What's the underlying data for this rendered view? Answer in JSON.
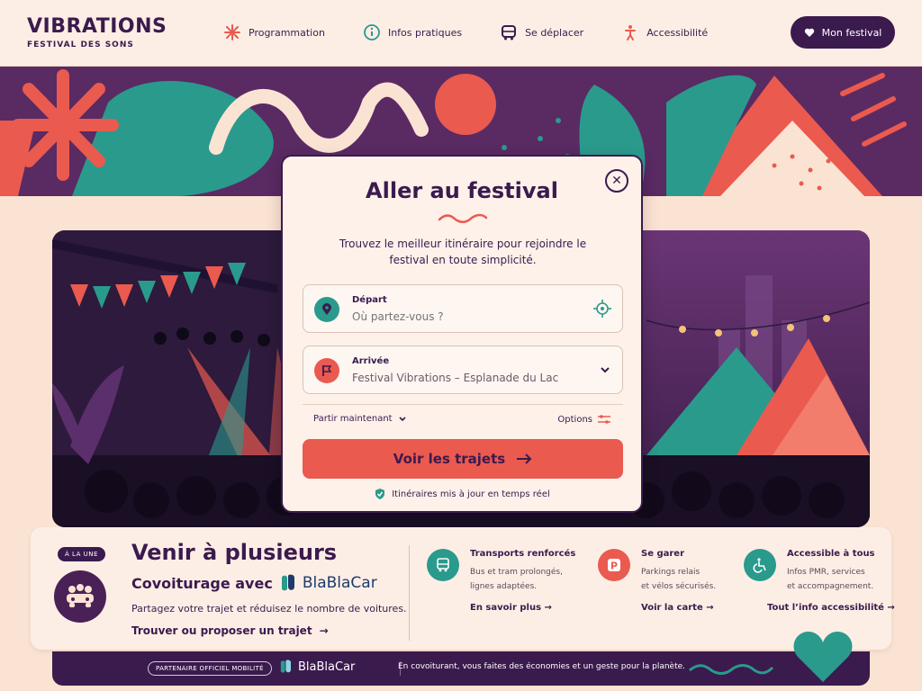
{
  "header": {
    "logo_title": "VIBRATIONS",
    "logo_subtitle": "FESTIVAL DES SONS",
    "nav": [
      {
        "label": "Programmation",
        "icon": "sparkle-icon"
      },
      {
        "label": "Infos pratiques",
        "icon": "info-icon"
      },
      {
        "label": "Se déplacer",
        "icon": "bus-icon"
      },
      {
        "label": "Accessibilité",
        "icon": "person-icon"
      }
    ],
    "festival_button": "Mon festival"
  },
  "modal": {
    "title": "Aller au festival",
    "description": "Trouvez le meilleur itinéraire pour rejoindre le festival en toute simplicité.",
    "departure": {
      "label": "Départ",
      "placeholder": "Où partez-vous ?"
    },
    "arrival": {
      "label": "Arrivée",
      "value": "Festival Vibrations – Esplanade du Lac"
    },
    "time_option": "Partir maintenant",
    "options_label": "Options",
    "cta": "Voir les trajets",
    "realtime_note": "Itinéraires mis à jour en temps réel"
  },
  "carpool": {
    "badge": "À LA UNE",
    "title": "Venir à plusieurs",
    "subtitle": "Covoiturage avec",
    "brand": "BlaBlaCar",
    "description": "Partagez votre trajet et réduisez le nombre de voitures.",
    "link": "Trouver ou proposer un trajet"
  },
  "features": [
    {
      "title": "Transports renforcés",
      "line1": "Bus et tram prolongés,",
      "line2": "lignes adaptées.",
      "link": "En savoir plus",
      "color": "#2a9a8c"
    },
    {
      "title": "Se garer",
      "line1": "Parkings relais",
      "line2": "et vélos sécurisés.",
      "link": "Voir la carte",
      "color": "#ea5a4f"
    },
    {
      "title": "Accessible à tous",
      "line1": "Infos PMR, services",
      "line2": "et accompagnement.",
      "link": "Tout l’info accessibilité",
      "color": "#2a9a8c"
    }
  ],
  "footer": {
    "partner_badge": "PARTENAIRE OFFICIEL MOBILITÉ",
    "brand": "BlaBlaCar",
    "text": "En covoiturant, vous faites des économies et un geste pour la planète."
  },
  "colors": {
    "primary": "#3b1a4e",
    "accent": "#ea5a4f",
    "teal": "#2a9a8c",
    "background": "#fbe3d3"
  }
}
